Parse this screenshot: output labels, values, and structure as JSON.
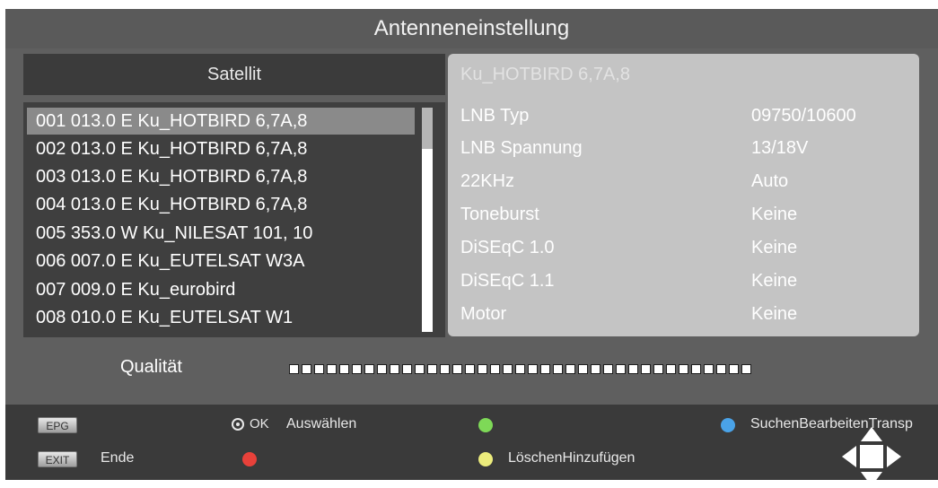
{
  "window": {
    "title": "Antenneneinstellung"
  },
  "satellite_list": {
    "header": "Satellit",
    "selected_index": 0,
    "items": [
      "001 013.0 E  Ku_HOTBIRD 6,7A,8",
      "002 013.0 E  Ku_HOTBIRD 6,7A,8",
      "003 013.0 E  Ku_HOTBIRD 6,7A,8",
      "004 013.0 E  Ku_HOTBIRD 6,7A,8",
      "005 353.0 W  Ku_NILESAT 101, 10",
      "006 007.0 E  Ku_EUTELSAT W3A",
      "007 009.0 E  Ku_eurobird",
      "008 010.0 E  Ku_EUTELSAT W1"
    ]
  },
  "details": {
    "title": "Ku_HOTBIRD 6,7A,8",
    "rows": [
      {
        "label": "LNB Typ",
        "value": "09750/10600"
      },
      {
        "label": "LNB Spannung",
        "value": "13/18V"
      },
      {
        "label": "22KHz",
        "value": "Auto"
      },
      {
        "label": "Toneburst",
        "value": "Keine"
      },
      {
        "label": "DiSEqC 1.0",
        "value": "Keine"
      },
      {
        "label": "DiSEqC 1.1",
        "value": "Keine"
      },
      {
        "label": "Motor",
        "value": "Keine"
      }
    ]
  },
  "quality": {
    "label": "Qualität",
    "level": 0,
    "segments": 37
  },
  "footer": {
    "epg_key": "EPG",
    "exit_key": "EXIT",
    "exit_label": "Ende",
    "ok_key": "OK",
    "ok_label": "Auswählen",
    "yellow_label": "LöschenHinzufügen",
    "blue_label": "SuchenBearbeitenTransp",
    "colors": {
      "green": "#7ed957",
      "red": "#e8413a",
      "yellow": "#ecec7c",
      "blue": "#4aa3e8"
    }
  }
}
